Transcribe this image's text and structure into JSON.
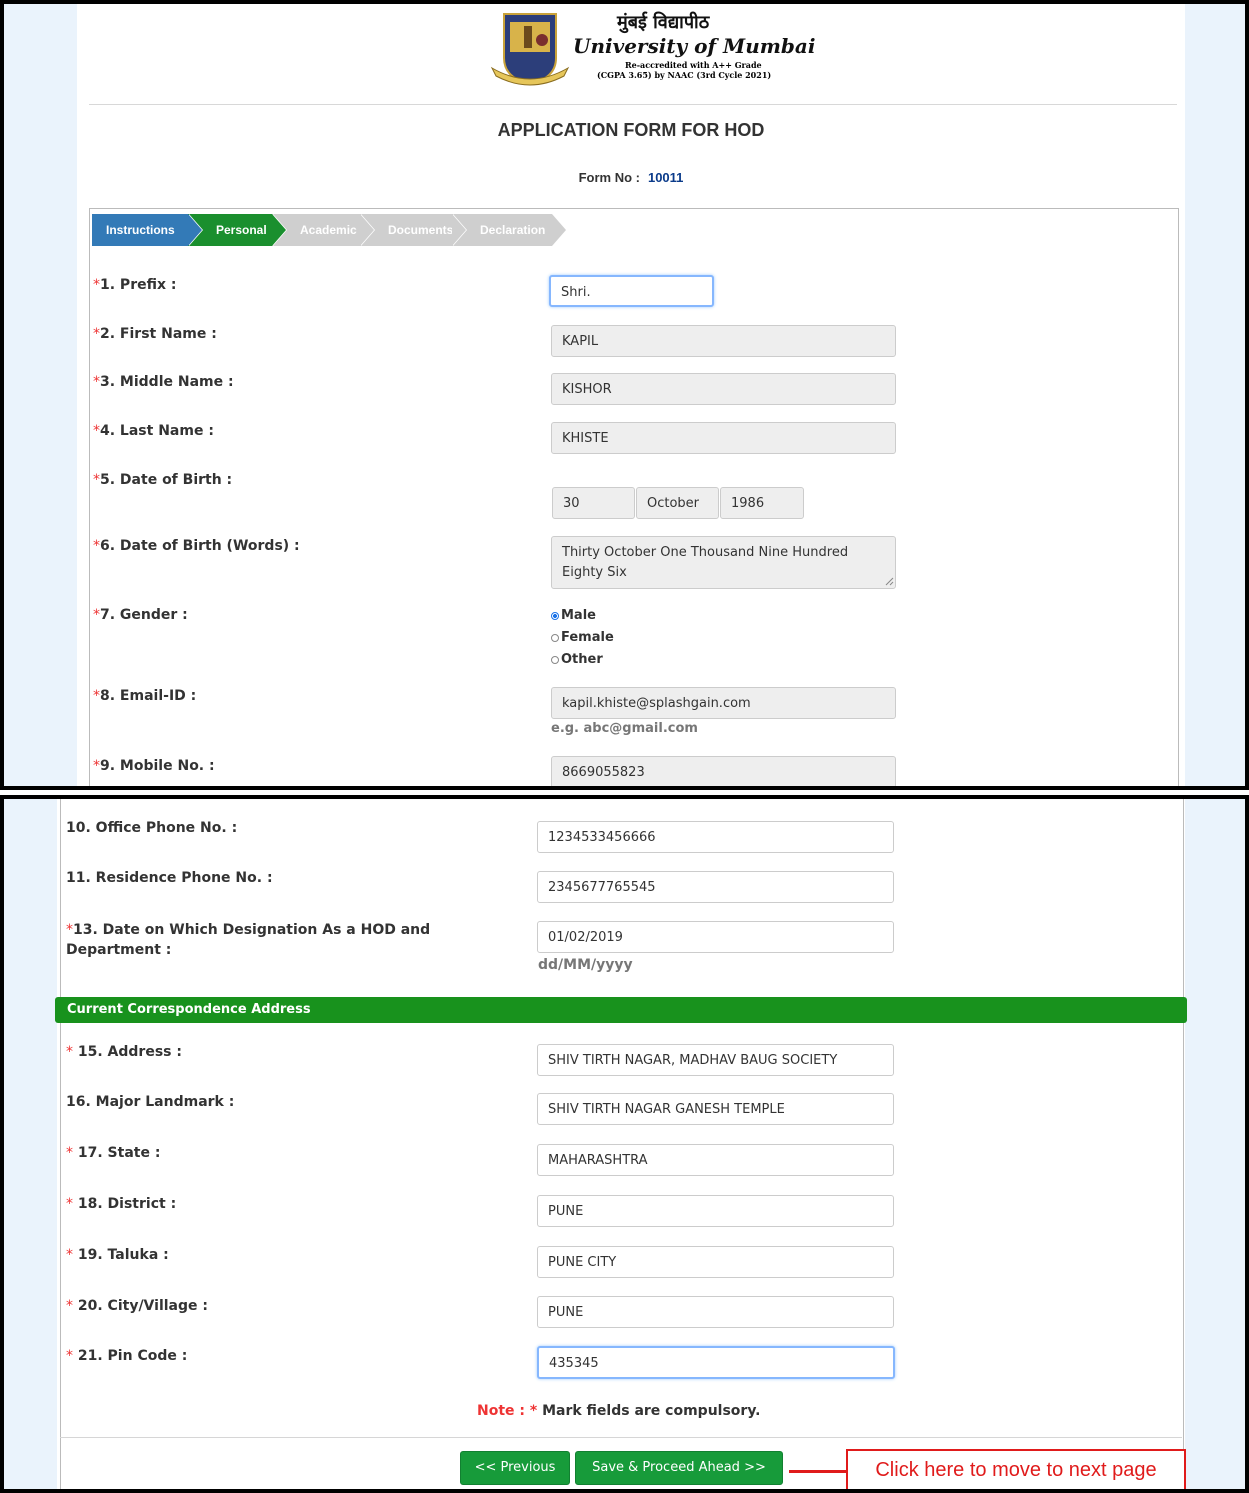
{
  "header": {
    "university_hindi": "मुंबई विद्यापीठ",
    "university_english": "University of Mumbai",
    "accreditation_line1": "Re-accredited with A++ Grade",
    "accreditation_line2": "(CGPA 3.65) by NAAC (3rd Cycle 2021)",
    "logo_icon": "university-crest-icon"
  },
  "form": {
    "title": "APPLICATION FORM FOR HOD",
    "form_no_label": "Form No :",
    "form_no_value": "10011"
  },
  "steps": [
    {
      "label": "Instructions",
      "color": "#337ab7"
    },
    {
      "label": "Personal",
      "color": "#1a8f2e"
    },
    {
      "label": "Academic",
      "color": "#cfcfcf"
    },
    {
      "label": "Documents",
      "color": "#cfcfcf"
    },
    {
      "label": "Declaration",
      "color": "#cfcfcf"
    }
  ],
  "required_marker": "*",
  "fields": {
    "prefix": {
      "label": "1. Prefix :",
      "value": "Shri."
    },
    "first_name": {
      "label": "2. First Name :",
      "value": "KAPIL"
    },
    "middle_name": {
      "label": "3. Middle Name :",
      "value": "KISHOR"
    },
    "last_name": {
      "label": "4. Last Name :",
      "value": "KHISTE"
    },
    "dob": {
      "label": "5. Date of Birth :",
      "day": "30",
      "month": "October",
      "year": "1986"
    },
    "dob_words": {
      "label": "6. Date of Birth (Words) :",
      "value": "Thirty October One Thousand Nine Hundred Eighty Six"
    },
    "gender": {
      "label": "7. Gender :",
      "options": [
        "Male",
        "Female",
        "Other"
      ],
      "selected": "Male"
    },
    "email": {
      "label": "8. Email-ID :",
      "value": "kapil.khiste@splashgain.com",
      "hint": "e.g. abc@gmail.com"
    },
    "mobile": {
      "label": "9. Mobile No. :",
      "value": "8669055823"
    },
    "office_phone": {
      "label": "10. Office Phone No. :",
      "value": "1234533456666"
    },
    "residence_phone": {
      "label": "11. Residence Phone No. :",
      "value": "2345677765545"
    },
    "designation_date": {
      "label_line1": "13. Date on Which Designation As a HOD and",
      "label_line2": "Department :",
      "value": "01/02/2019",
      "hint": "dd/MM/yyyy"
    }
  },
  "address_section": {
    "title": "Current Correspondence Address",
    "address": {
      "label": " 15. Address :",
      "value": "SHIV TIRTH NAGAR, MADHAV BAUG SOCIETY"
    },
    "landmark": {
      "label": "16. Major Landmark :",
      "value": "SHIV TIRTH NAGAR GANESH TEMPLE"
    },
    "state": {
      "label": " 17. State :",
      "value": "MAHARASHTRA"
    },
    "district": {
      "label": " 18. District :",
      "value": "PUNE"
    },
    "taluka": {
      "label": " 19. Taluka :",
      "value": "PUNE CITY"
    },
    "city": {
      "label": " 20. City/Village :",
      "value": "PUNE"
    },
    "pincode": {
      "label": " 21. Pin Code :",
      "value": "435345"
    }
  },
  "note": {
    "prefix": "Note :",
    "star": "*",
    "text": " Mark fields are compulsory."
  },
  "buttons": {
    "previous": "<< Previous",
    "save_proceed": "Save & Proceed Ahead >>"
  },
  "callout": "Click here to move to next page"
}
